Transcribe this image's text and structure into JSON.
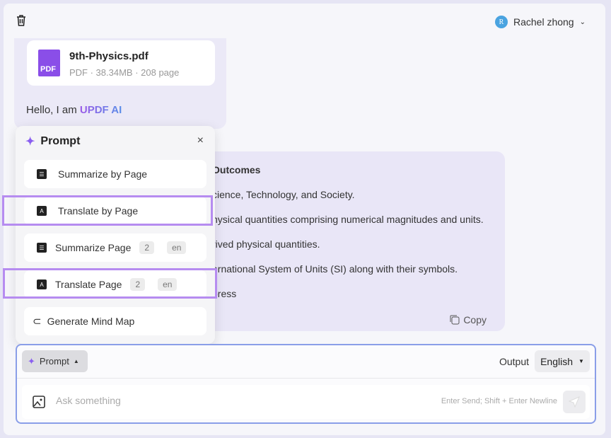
{
  "header": {
    "user_initial": "R",
    "user_name": "Rachel zhong"
  },
  "file": {
    "name": "9th-Physics.pdf",
    "meta": "PDF · 38.34MB · 208 page",
    "icon_label": "PDF"
  },
  "greeting": {
    "prefix": "Hello, I am ",
    "brand": "UPDF AI"
  },
  "response": {
    "lines": [
      "Outcomes",
      "cience, Technology, and Society.",
      "hysical quantities comprising numerical magnitudes and units.",
      "rived physical quantities.",
      "ernational System of Units (SI) along with their symbols.",
      "press"
    ],
    "copy_label": "Copy"
  },
  "prompt_menu": {
    "title": "Prompt",
    "items": [
      {
        "label": "Summarize by Page",
        "icon": "list-icon"
      },
      {
        "label": "Translate by Page",
        "icon": "translate-icon"
      },
      {
        "label": "Summarize Page",
        "icon": "list-icon",
        "page": "2",
        "lang": "en"
      },
      {
        "label": "Translate Page",
        "icon": "translate-icon",
        "page": "2",
        "lang": "en"
      },
      {
        "label": "Generate Mind Map",
        "icon": "mindmap-icon"
      }
    ]
  },
  "input": {
    "prompt_label": "Prompt",
    "output_label": "Output",
    "language": "English",
    "placeholder": "Ask something",
    "hint": "Enter Send; Shift + Enter Newline"
  },
  "colors": {
    "highlight": "#b68cf0",
    "accent": "#8a4ee8"
  }
}
